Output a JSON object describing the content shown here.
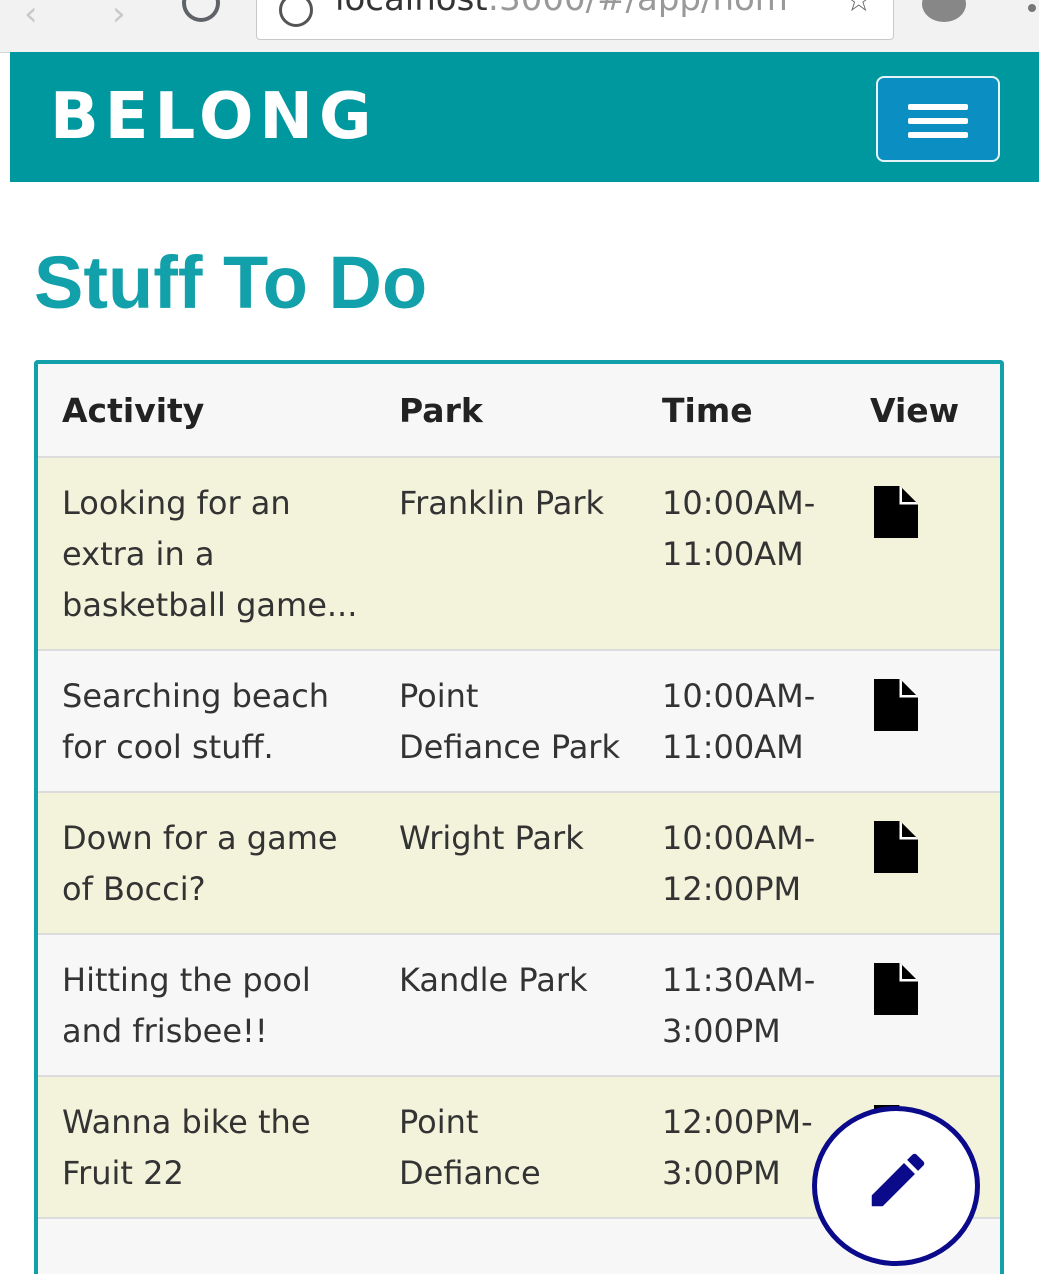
{
  "browser": {
    "url_host": "localhost",
    "url_rest": ":3000/#/app/hom"
  },
  "navbar": {
    "brand": "BELONG",
    "menu_toggle_icon": "hamburger-icon"
  },
  "page": {
    "title": "Stuff To Do"
  },
  "table": {
    "headers": [
      "Activity",
      "Park",
      "Time",
      "View"
    ],
    "view_icon": "document-icon",
    "rows": [
      {
        "activity": "Looking for an extra in a basketball game...",
        "park": "Franklin Park",
        "time": "10:00AM-11:00AM"
      },
      {
        "activity": "Searching beach for cool stuff.",
        "park": "Point Defiance Park",
        "time": "10:00AM-11:00AM"
      },
      {
        "activity": "Down for a game of Bocci?",
        "park": "Wright Park",
        "time": "10:00AM-12:00PM"
      },
      {
        "activity": "Hitting the pool and frisbee!!",
        "park": "Kandle Park",
        "time": "11:30AM-3:00PM"
      },
      {
        "activity": "Wanna bike the Fruit 22",
        "park": "Point Defiance",
        "time": "12:00PM-3:00PM"
      }
    ]
  },
  "fab": {
    "icon": "pencil-icon"
  },
  "colors": {
    "navbar": "#00989f",
    "accent": "#12a0aa",
    "toggler": "#0b8fc2",
    "row_odd": "#f3f3dc",
    "row_even": "#f7f7f7",
    "fab_border": "#0a0a8a"
  }
}
